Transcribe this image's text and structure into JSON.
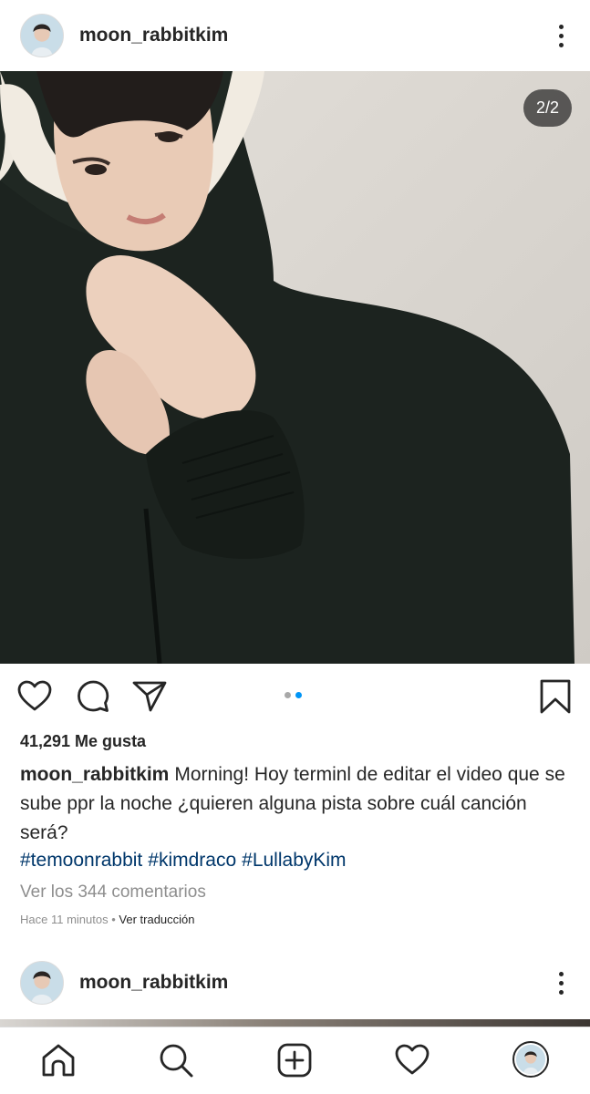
{
  "post": {
    "username": "moon_rabbitkim",
    "image_counter": "2/2",
    "carousel": {
      "total": 2,
      "active_index": 1
    },
    "likes": "41,291 Me gusta",
    "caption_user": "moon_rabbitkim",
    "caption_text": "Morning! Hoy terminl de editar el video que se sube ppr la noche ¿quieren alguna pista sobre cuál canción será?",
    "hashtags": [
      "#temoonrabbit",
      "#kimdraco",
      "#LullabyKim"
    ],
    "view_comments": "Ver los 344 comentarios",
    "time_ago": "Hace 11 minutos",
    "separator": "•",
    "translate": "Ver traducción"
  },
  "next_post": {
    "username": "moon_rabbitkim"
  },
  "icons": {
    "like": "heart-icon",
    "comment": "comment-icon",
    "share": "send-icon",
    "save": "bookmark-icon",
    "home": "home-icon",
    "search": "search-icon",
    "new_post": "plus-square-icon",
    "activity": "heart-icon",
    "profile": "avatar"
  },
  "colors": {
    "hashtag": "#00376b",
    "carousel_active": "#0095f6",
    "muted_text": "#8e8e8e"
  }
}
